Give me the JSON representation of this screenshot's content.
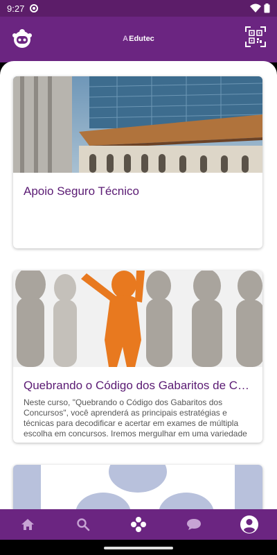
{
  "status_bar": {
    "time": "9:27"
  },
  "app_bar": {
    "brand_mark": "A",
    "brand_name": "Edutec"
  },
  "courses": [
    {
      "title": "Apoio Seguro Técnico",
      "description": ""
    },
    {
      "title": "Quebrando o Código dos Gabaritos de Concursos",
      "description": "Neste curso, \"Quebrando o Código dos Gabaritos dos Concursos\", você aprenderá as principais estratégias e técnicas para decodificar e acertar em exames de múltipla escolha em concursos. Iremos mergulhar em uma variedade"
    },
    {
      "title": "",
      "description": ""
    }
  ],
  "bottom_nav": [
    "home-icon",
    "search-icon",
    "apps-icon",
    "chat-icon",
    "profile-icon"
  ],
  "colors": {
    "primary": "#6b2581",
    "status_bar": "#5c1d69",
    "title": "#5a1a73"
  }
}
